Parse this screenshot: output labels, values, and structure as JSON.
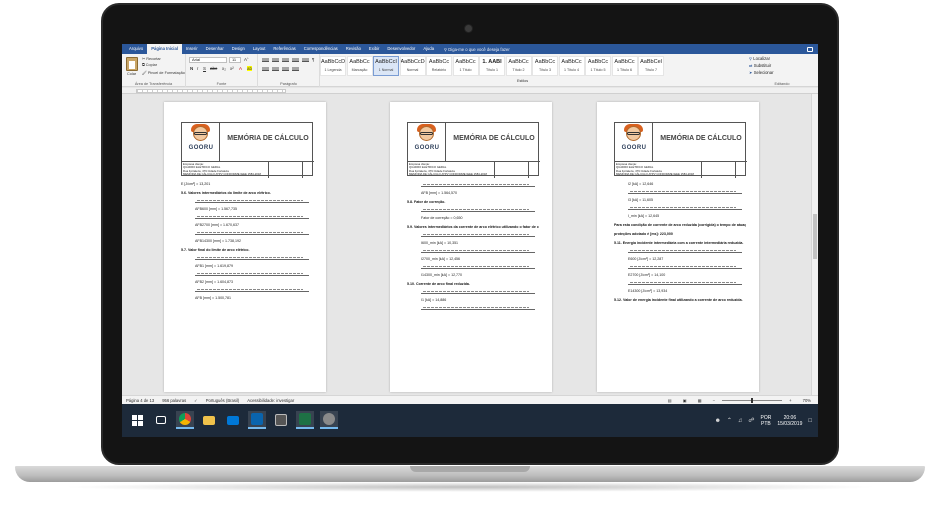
{
  "ribbon": {
    "tabs": [
      "Arquivo",
      "Página Inicial",
      "Inserir",
      "Desenhar",
      "Design",
      "Layout",
      "Referências",
      "Correspondências",
      "Revisão",
      "Exibir",
      "Desenvolvedor",
      "Ajuda"
    ],
    "active_tab": "Página Inicial",
    "tell_me": "Diga-me o que você deseja fazer",
    "clipboard": {
      "paste": "Colar",
      "cut": "Recortar",
      "copy": "Copiar",
      "format_painter": "Pincel de Formatação",
      "group": "Área de Transferência"
    },
    "font": {
      "name": "Arial",
      "size": "11",
      "group": "Fonte"
    },
    "paragraph": {
      "group": "Parágrafo"
    },
    "styles": {
      "group": "Estilos",
      "items": [
        {
          "sample": "AaBbCcDd",
          "name": "1 Legenda"
        },
        {
          "sample": "AaBbCc",
          "name": "Marcação"
        },
        {
          "sample": "AaBbCcI",
          "name": "1 Normal"
        },
        {
          "sample": "AaBbCcDd",
          "name": "Normal"
        },
        {
          "sample": "AaBbCc",
          "name": "Relatório"
        },
        {
          "sample": "AaBbCc",
          "name": "1 Título"
        },
        {
          "sample": "1. AABI",
          "name": "Título 1"
        },
        {
          "sample": "AaBbCc",
          "name": "Título 2"
        },
        {
          "sample": "AaBbCc",
          "name": "Título 3"
        },
        {
          "sample": "AaBbCc",
          "name": "1 Título 4"
        },
        {
          "sample": "AaBbCc",
          "name": "1 Título 5"
        },
        {
          "sample": "AaBbCc",
          "name": "1 Título 6"
        },
        {
          "sample": "AaBbCel",
          "name": "Título 7"
        }
      ],
      "selected": 2
    },
    "editing": {
      "find": "Localizar",
      "replace": "Substituir",
      "select": "Selecionar",
      "group": "Editando"
    }
  },
  "pages": [
    {
      "header": {
        "logo": "GOORU",
        "title": "MEMÓRIA DE CÁLCULO",
        "info": [
          "Empresa cliente:",
          "QUADRO ELÉTRICO GERAL",
          "Rua Fortaleza, 479 Cidade Fortaleza",
          "MEMÓRIA DE CÁLCULO ATPV CONFORME IEEE 1584-2018"
        ]
      },
      "lines": [
        {
          "kind": "text",
          "text": "E [J/cm²] = 13,201"
        },
        {
          "kind": "heading",
          "text": "5.6. Valores intermediários do limite de arco elétrico."
        },
        {
          "kind": "formula"
        },
        {
          "kind": "result",
          "text": "AFB600 [mm] = 1.567,735"
        },
        {
          "kind": "formula"
        },
        {
          "kind": "result",
          "text": "AFB2700 [mm] = 1.670,637"
        },
        {
          "kind": "formula"
        },
        {
          "kind": "result",
          "text": "AFB14300 [mm] = 1.738,192"
        },
        {
          "kind": "heading",
          "text": "5.7. Valor final do limite de arco elétrico."
        },
        {
          "kind": "formula"
        },
        {
          "kind": "result",
          "text": "AFB1 [mm] = 1.619,879"
        },
        {
          "kind": "formula"
        },
        {
          "kind": "result",
          "text": "AFB2 [mm] = 1.604,873"
        },
        {
          "kind": "formula"
        },
        {
          "kind": "result",
          "text": "AFB [mm] = 1.500,781"
        }
      ]
    },
    {
      "header": {
        "logo": "GOORU",
        "title": "MEMÓRIA DE CÁLCULO",
        "info": [
          "Empresa cliente:",
          "QUADRO ELÉTRICO GERAL",
          "Rua Fortaleza, 479 Cidade Fortaleza",
          "MEMÓRIA DE CÁLCULO ATPV CONFORME IEEE 1584-2018"
        ]
      },
      "lines": [
        {
          "kind": "formula"
        },
        {
          "kind": "result",
          "text": "AFB [mm] = 1.564,570"
        },
        {
          "kind": "heading",
          "text": "5.8. Fator de correção."
        },
        {
          "kind": "formula"
        },
        {
          "kind": "result",
          "text": "Fator de correção = 0,650"
        },
        {
          "kind": "heading",
          "text": "5.9. Valores intermediários da corrente de arco elétrico utilizando o fator de correção."
        },
        {
          "kind": "formula"
        },
        {
          "kind": "result",
          "text": "I600_min [kA] = 10,351"
        },
        {
          "kind": "formula"
        },
        {
          "kind": "result",
          "text": "I2700_min [kA] = 12,456"
        },
        {
          "kind": "formula"
        },
        {
          "kind": "result",
          "text": "I14300_min [kA] = 12,770"
        },
        {
          "kind": "heading",
          "text": "5.10. Corrente de arco final reduzida."
        },
        {
          "kind": "formula"
        },
        {
          "kind": "result",
          "text": "I1 [kA] = 14,886"
        },
        {
          "kind": "formula"
        }
      ]
    },
    {
      "header": {
        "logo": "GOORU",
        "title": "MEMÓRIA DE CÁLCULO",
        "info": [
          "Empresa cliente:",
          "QUADRO ELÉTRICO GERAL",
          "Rua Fortaleza, 479 Cidade Fortaleza",
          "MEMÓRIA DE CÁLCULO ATPV CONFORME IEEE 1584-2018"
        ]
      },
      "lines": [
        {
          "kind": "result",
          "text": "I2 [kA] = 12,646"
        },
        {
          "kind": "formula"
        },
        {
          "kind": "result",
          "text": "I3 [kA] = 11,605"
        },
        {
          "kind": "formula"
        },
        {
          "kind": "result",
          "text": "I_min [kA] = 12,645"
        },
        {
          "kind": "heading",
          "text": "Para esta condição de corrente de arco reduzida (corrigida) o tempo de atuação das"
        },
        {
          "kind": "heading",
          "text": "proteções adotado é [ms]: 223,000"
        },
        {
          "kind": "heading",
          "text": "5.11. Energia incidente intermediária com a corrente intermediária reduzida."
        },
        {
          "kind": "formula"
        },
        {
          "kind": "result",
          "text": "E600 [J/cm²] = 12,287"
        },
        {
          "kind": "formula"
        },
        {
          "kind": "result",
          "text": "E2700 [J/cm²] = 14,100"
        },
        {
          "kind": "formula"
        },
        {
          "kind": "result",
          "text": "E14300 [J/cm²] = 13,934"
        },
        {
          "kind": "heading",
          "text": "5.12. Valor de energia incidente final utilizando a corrente de arco reduzida."
        }
      ]
    }
  ],
  "status": {
    "page": "Página 4 de 13",
    "words": "956 palavras",
    "language": "Português (Brasil)",
    "accessibility": "Acessibilidade: investigar",
    "zoom": "70%"
  },
  "taskbar": {
    "apps": [
      "windows-start",
      "task-view",
      "chrome",
      "file-explorer",
      "mail",
      "outlook",
      "calculator",
      "excel",
      "snipping-tool"
    ],
    "lang_line1": "POR",
    "lang_line2": "PTB",
    "time": "20:06",
    "date": "15/03/2019"
  },
  "colors": {
    "word_blue": "#2b579a",
    "taskbar": "#1d2a3a"
  }
}
